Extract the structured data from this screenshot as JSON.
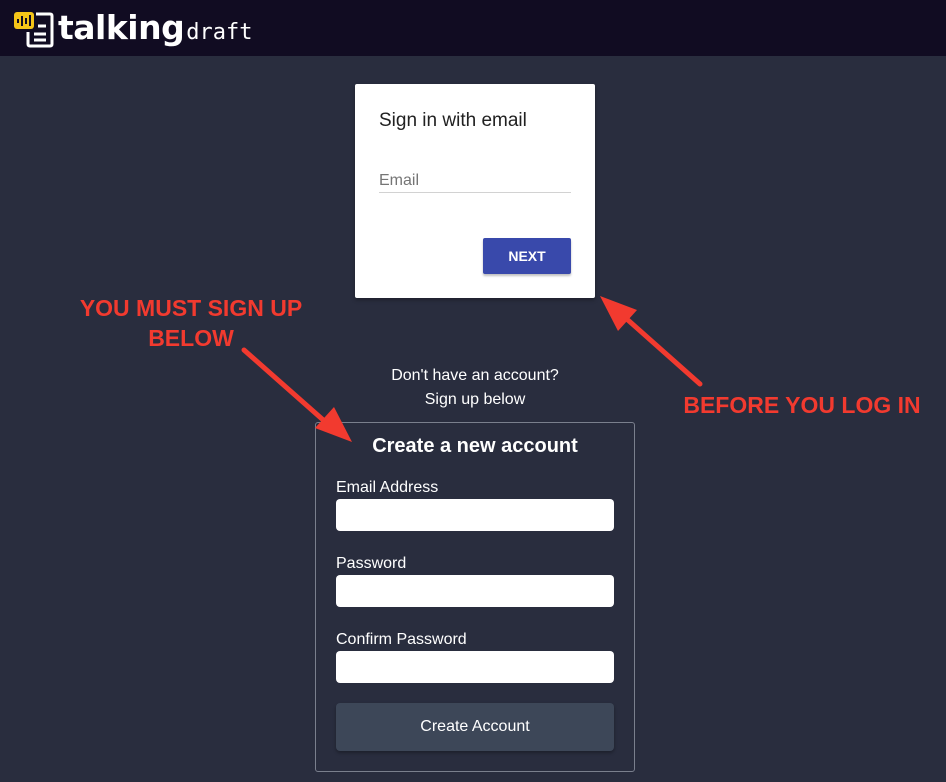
{
  "header": {
    "logo_main": "talking",
    "logo_sub": "draft"
  },
  "signin": {
    "title": "Sign in with email",
    "email_placeholder": "Email",
    "next_label": "NEXT"
  },
  "signup_prompt": {
    "line1": "Don't have an account?",
    "line2": "Sign up below"
  },
  "create_account": {
    "title": "Create a new account",
    "email_label": "Email Address",
    "password_label": "Password",
    "confirm_label": "Confirm Password",
    "button_label": "Create Account"
  },
  "annotations": {
    "left_line1": "YOU MUST SIGN UP",
    "left_line2": "BELOW",
    "right": "BEFORE YOU LOG IN"
  },
  "colors": {
    "page_bg": "#292d3e",
    "topbar_bg": "#110c22",
    "brand_yellow": "#f5c518",
    "primary_button": "#3949ab",
    "annotation_red": "#f23a2f",
    "create_button": "#3d4758"
  },
  "icons": {
    "logo": "document-waveform-icon"
  }
}
